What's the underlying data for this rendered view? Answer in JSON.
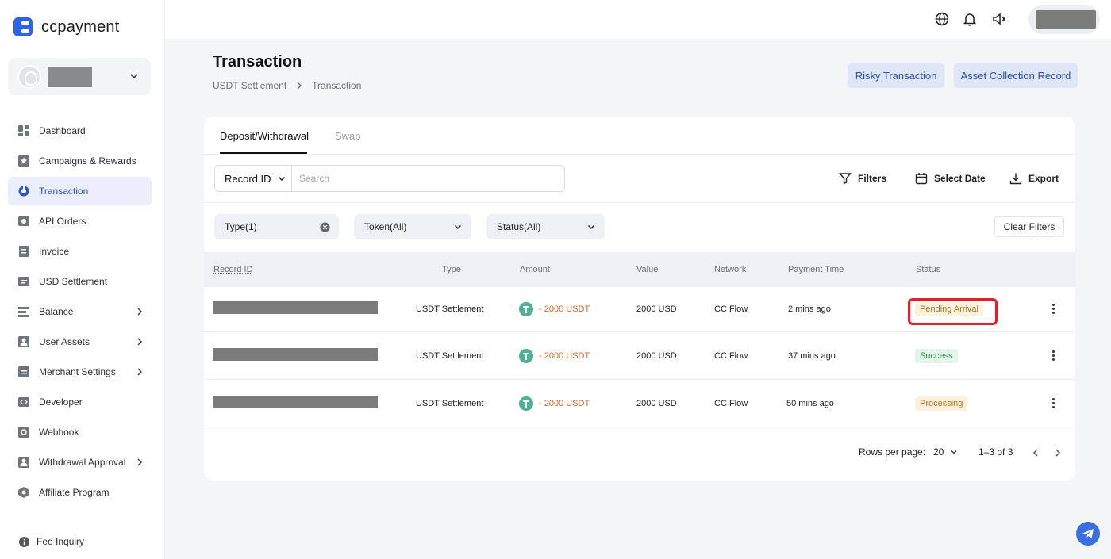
{
  "brand": {
    "name": "ccpayment"
  },
  "sidebar": {
    "items": [
      {
        "label": "Dashboard",
        "icon": "dashboard-icon"
      },
      {
        "label": "Campaigns & Rewards",
        "icon": "star-icon"
      },
      {
        "label": "Transaction",
        "icon": "transaction-icon",
        "active": true
      },
      {
        "label": "API Orders",
        "icon": "api-icon"
      },
      {
        "label": "Invoice",
        "icon": "invoice-icon"
      },
      {
        "label": "USD Settlement",
        "icon": "usd-icon"
      },
      {
        "label": "Balance",
        "icon": "balance-icon",
        "expandable": true
      },
      {
        "label": "User Assets",
        "icon": "user-icon",
        "expandable": true
      },
      {
        "label": "Merchant Settings",
        "icon": "merchant-icon",
        "expandable": true
      },
      {
        "label": "Developer",
        "icon": "code-icon"
      },
      {
        "label": "Webhook",
        "icon": "webhook-icon"
      },
      {
        "label": "Withdrawal Approval",
        "icon": "approval-icon",
        "expandable": true
      },
      {
        "label": "Affiliate Program",
        "icon": "affiliate-icon"
      }
    ],
    "footer": {
      "label": "Fee Inquiry"
    }
  },
  "page": {
    "title": "Transaction",
    "breadcrumb": [
      "USDT Settlement",
      "Transaction"
    ],
    "buttons": {
      "risky": "Risky Transaction",
      "asset": "Asset Collection Record"
    }
  },
  "tabs": [
    "Deposit/Withdrawal",
    "Swap"
  ],
  "search": {
    "field": "Record ID",
    "placeholder": "Search"
  },
  "tools": {
    "filters": "Filters",
    "date": "Select Date",
    "export": "Export"
  },
  "filters": {
    "type": "Type(1)",
    "token": "Token(All)",
    "status": "Status(All)",
    "clear": "Clear Filters"
  },
  "table": {
    "headers": [
      "Record ID",
      "Type",
      "Amount",
      "Value",
      "Network",
      "Payment Time",
      "Status"
    ],
    "rows": [
      {
        "type": "USDT Settlement",
        "amount": "- 2000 USDT",
        "value": "2000 USD",
        "network": "CC Flow",
        "time": "2 mins ago",
        "status": "Pending Arrival"
      },
      {
        "type": "USDT Settlement",
        "amount": "- 2000 USDT",
        "value": "2000 USD",
        "network": "CC Flow",
        "time": "37 mins ago",
        "status": "Success"
      },
      {
        "type": "USDT Settlement",
        "amount": "- 2000 USDT",
        "value": "2000 USD",
        "network": "CC Flow",
        "time": "50 mins ago",
        "status": "Processing"
      }
    ]
  },
  "pagination": {
    "label": "Rows per page:",
    "size": "20",
    "range": "1–3 of 3"
  }
}
